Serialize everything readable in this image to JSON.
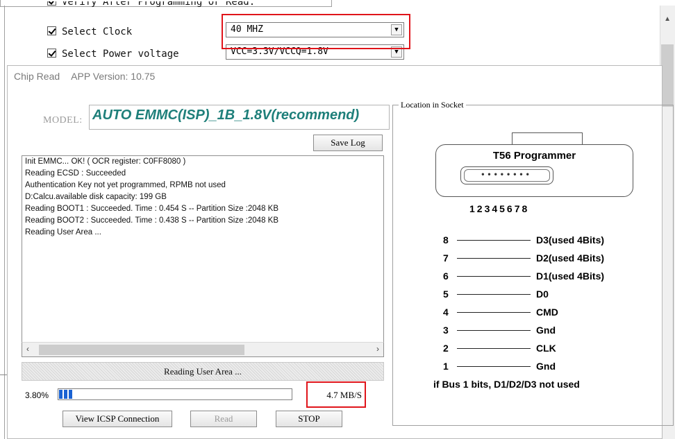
{
  "settings": {
    "partial_row": "Verify After Programming or Read.",
    "select_clock_label": "Select Clock",
    "select_clock_value": "40 MHZ",
    "select_power_label": "Select Power voltage",
    "select_power_value": "VCC=3.3V/VCCQ=1.8V"
  },
  "dialog": {
    "title": "Chip Read",
    "app_version": "APP Version: 10.75",
    "model_label": "MODEL:",
    "model_value": "AUTO EMMC(ISP)_1B_1.8V(recommend)",
    "save_log_label": "Save Log",
    "log_lines": [
      "Init EMMC... OK!   ( OCR register: C0FF8080 )",
      "Reading ECSD : Succeeded",
      "    Authentication Key not yet programmed, RPMB not used",
      "D:Calcu.available disk capacity: 199 GB",
      "Reading BOOT1 : Succeeded. Time : 0.454 S -- Partition Size :2048 KB",
      "Reading BOOT2 : Succeeded. Time : 0.438 S -- Partition Size :2048 KB",
      "Reading User Area ..."
    ],
    "status_text": "Reading User Area ...",
    "progress_percent_label": "3.80%",
    "progress_fraction": 0.038,
    "speed": "4.7 MB/S",
    "buttons": {
      "view_icsp": "View ICSP Connection",
      "read": "Read",
      "stop": "STOP"
    }
  },
  "socket": {
    "legend": "Location in Socket",
    "programmer_name": "T56 Programmer",
    "pin_dots": "••••••••",
    "pin_numbers": "12345678",
    "pins": [
      {
        "num": "8",
        "label": "D3(used 4Bits)"
      },
      {
        "num": "7",
        "label": "D2(used 4Bits)"
      },
      {
        "num": "6",
        "label": "D1(used 4Bits)"
      },
      {
        "num": "5",
        "label": "D0"
      },
      {
        "num": "4",
        "label": "CMD"
      },
      {
        "num": "3",
        "label": "Gnd"
      },
      {
        "num": "2",
        "label": "CLK"
      },
      {
        "num": "1",
        "label": "Gnd"
      }
    ],
    "bus_note": "if Bus  1 bits, D1/D2/D3 not used"
  },
  "colors": {
    "highlight": "#e0141a",
    "model_text": "#1e7f7a",
    "progress_fill": "#1a62d2"
  },
  "icons": [
    "checkbox-checked-icon",
    "dropdown-arrow-icon",
    "scroll-up-arrow-icon",
    "scroll-left-arrow-icon",
    "scroll-right-arrow-icon"
  ]
}
